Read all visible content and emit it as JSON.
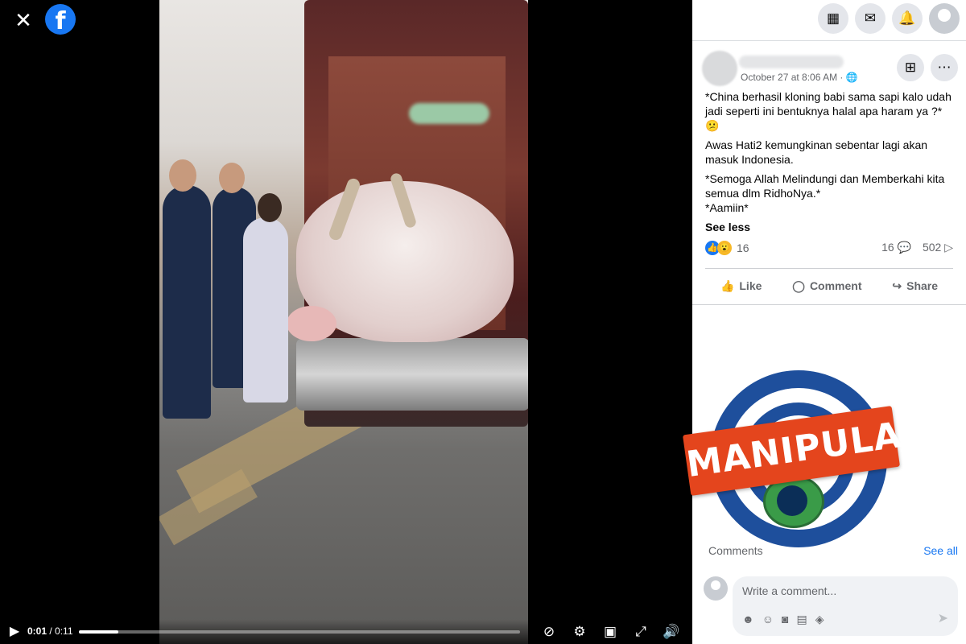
{
  "viewer": {
    "close_icon": "close-icon",
    "logo": "facebook-logo",
    "time_current": "0:01",
    "time_total": "/ 0:11",
    "progress": 0.09
  },
  "panel": {
    "post": {
      "date": "October 27 at 8:06 AM · ",
      "paragraphs": [
        "*China berhasil kloning babi sama sapi kalo udah jadi seperti ini bentuknya halal apa haram ya ?* 😕",
        "Awas Hati2 kemungkinan sebentar lagi akan masuk Indonesia.",
        "*Semoga Allah Melindungi dan Memberkahi kita semua dlm RidhoNya.*",
        "*Aamiin*"
      ],
      "see_less": "See less",
      "reaction_count": "16",
      "comment_count": "16",
      "share_count": "502",
      "like_label": "Like",
      "comment_label": "Comment",
      "share_label": "Share"
    },
    "overlay_stamp": "MANIPULASI",
    "comments_label": "Comments",
    "see_all": "See all",
    "composer_placeholder": "Write a comment..."
  }
}
